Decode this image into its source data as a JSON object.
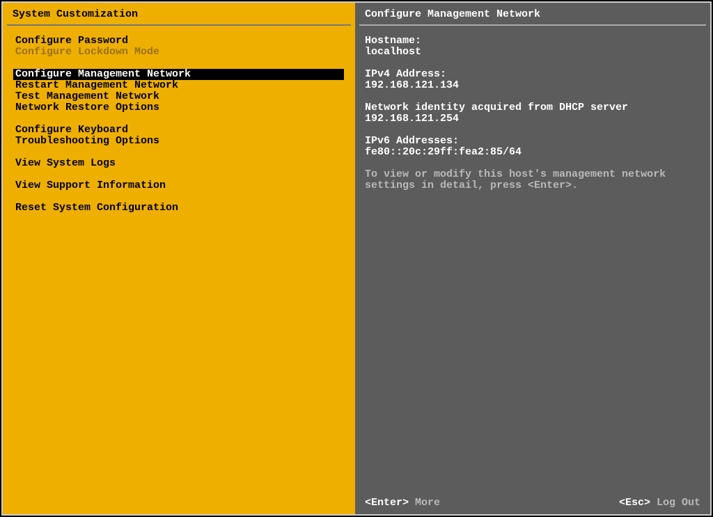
{
  "left": {
    "title": "System Customization",
    "groups": [
      [
        {
          "label": "Configure Password",
          "state": "normal"
        },
        {
          "label": "Configure Lockdown Mode",
          "state": "disabled"
        }
      ],
      [
        {
          "label": "Configure Management Network",
          "state": "selected"
        },
        {
          "label": "Restart Management Network",
          "state": "normal"
        },
        {
          "label": "Test Management Network",
          "state": "normal"
        },
        {
          "label": "Network Restore Options",
          "state": "normal"
        }
      ],
      [
        {
          "label": "Configure Keyboard",
          "state": "normal"
        },
        {
          "label": "Troubleshooting Options",
          "state": "normal"
        }
      ],
      [
        {
          "label": "View System Logs",
          "state": "normal"
        }
      ],
      [
        {
          "label": "View Support Information",
          "state": "normal"
        }
      ],
      [
        {
          "label": "Reset System Configuration",
          "state": "normal"
        }
      ]
    ]
  },
  "right": {
    "title": "Configure Management Network",
    "hostname_label": "Hostname:",
    "hostname_value": "localhost",
    "ipv4_label": "IPv4 Address:",
    "ipv4_value": "192.168.121.134",
    "dhcp_line": "Network identity acquired from DHCP server 192.168.121.254",
    "ipv6_label": "IPv6 Addresses:",
    "ipv6_value": "fe80::20c:29ff:fea2:85/64",
    "hint": "To view or modify this host's management network settings in detail, press <Enter>.",
    "footer": {
      "enter_key": "<Enter>",
      "enter_label": "More",
      "esc_key": "<Esc>",
      "esc_label": "Log Out"
    }
  }
}
